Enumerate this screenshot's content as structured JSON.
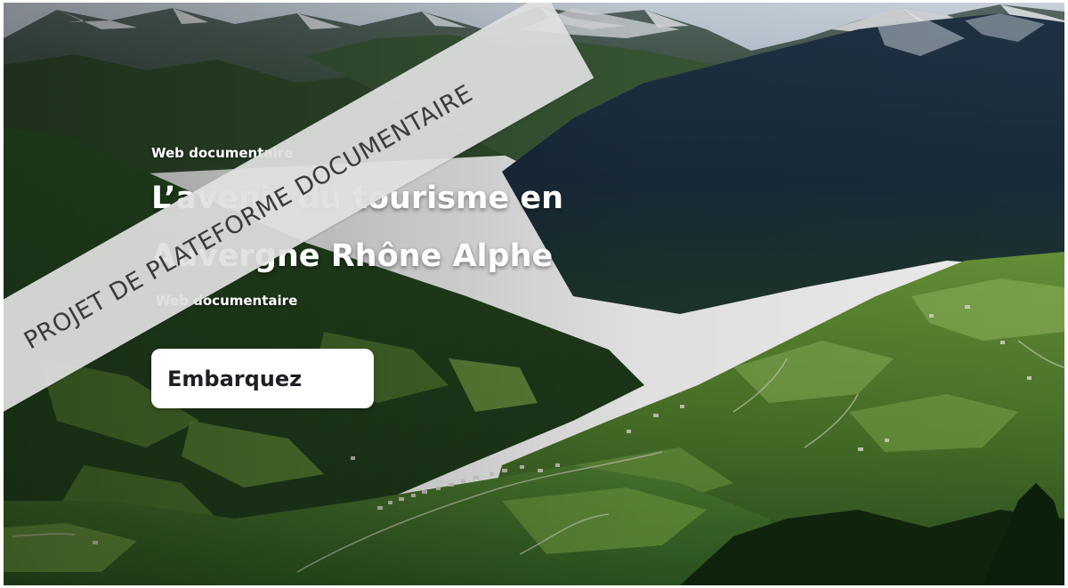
{
  "hero": {
    "kicker": "Web documentaire",
    "title": "L’avenir du tourisme en Auvergne Rhône Alphe",
    "subtitle": "Web documentaire",
    "cta_label": "Embarquez"
  },
  "watermark": {
    "text": "PROJET DE PLATEFORME DOCUMENTAIRE"
  },
  "background": {
    "subject": "alpine valley with snow-capped peaks, forests and a village",
    "colors": {
      "sky": "#c9d8e8",
      "snow": "#eef2f6",
      "forest": "#1f3d1f",
      "meadow": "#5f8a34",
      "valley_shadow": "#1c2d3c"
    }
  }
}
